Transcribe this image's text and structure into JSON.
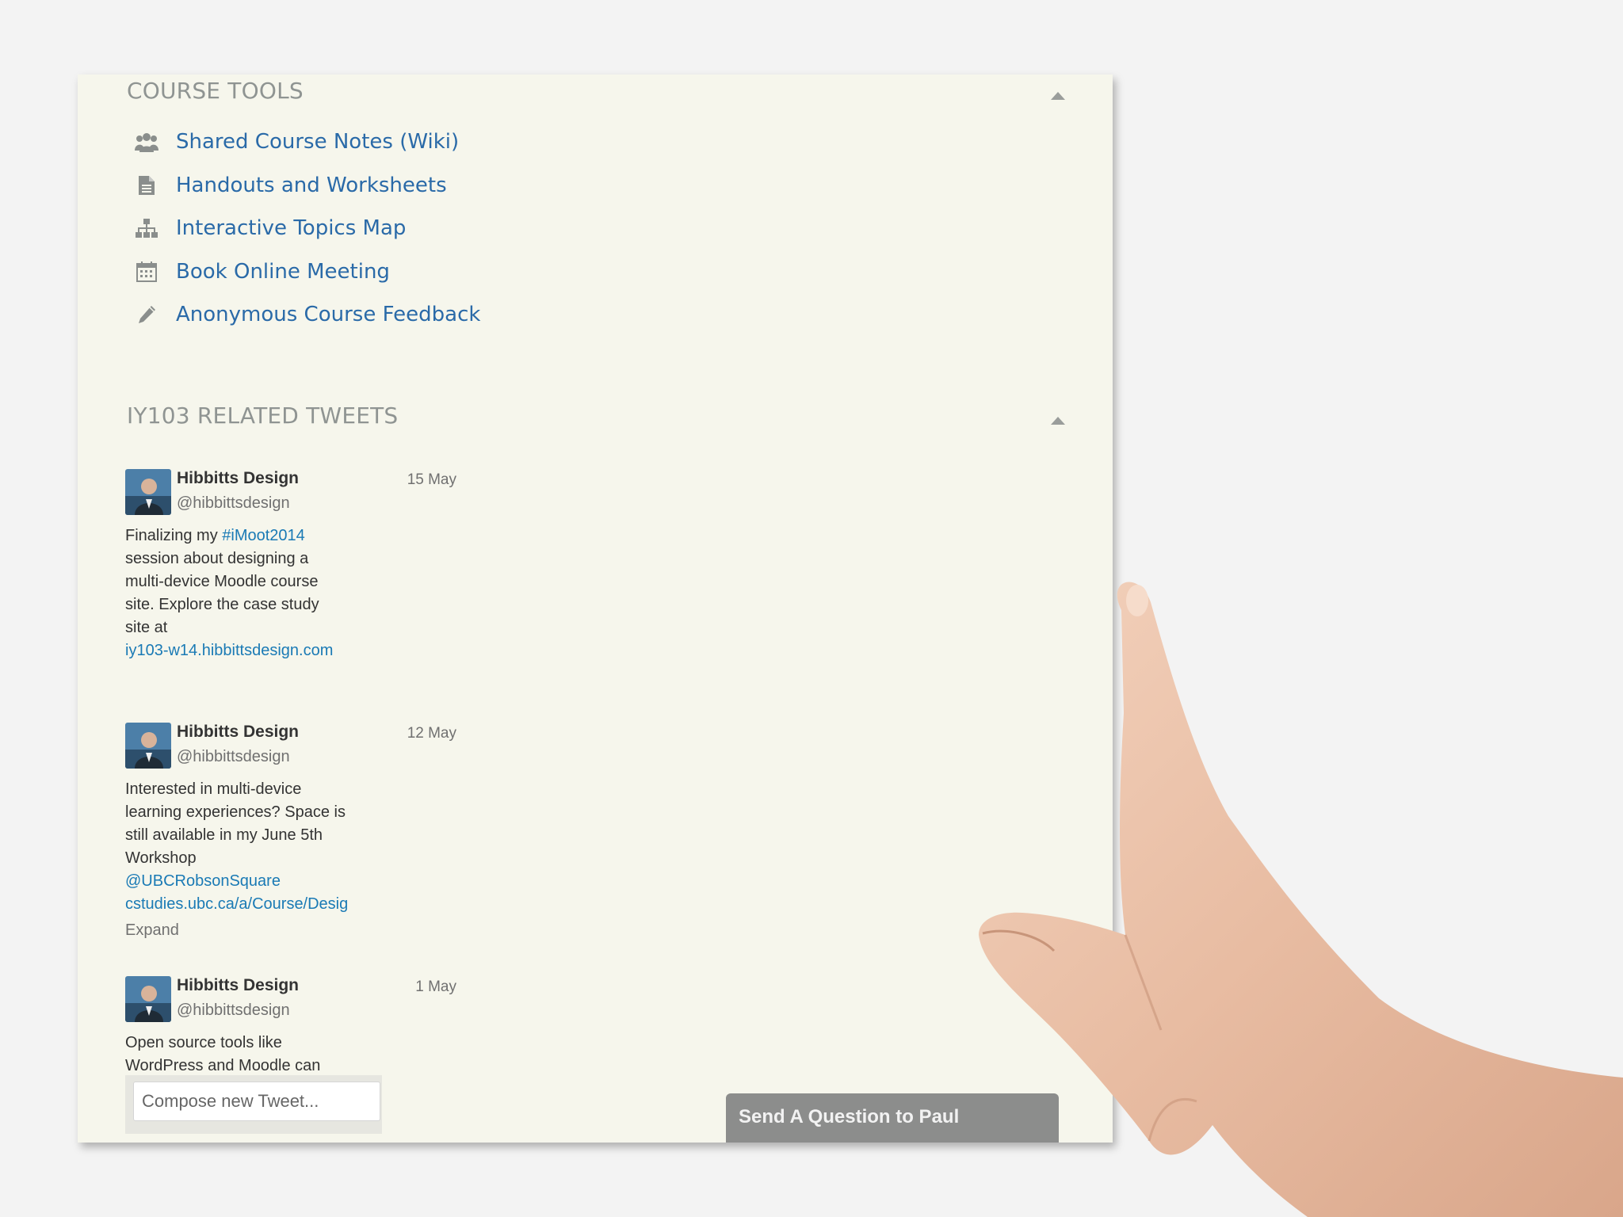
{
  "course_tools": {
    "title": "COURSE TOOLS",
    "items": [
      {
        "label": "Shared Course Notes (Wiki)",
        "icon": "users-icon"
      },
      {
        "label": "Handouts and Worksheets",
        "icon": "document-icon"
      },
      {
        "label": "Interactive Topics Map",
        "icon": "sitemap-icon"
      },
      {
        "label": "Book Online Meeting",
        "icon": "calendar-icon"
      },
      {
        "label": "Anonymous Course Feedback",
        "icon": "pencil-icon"
      }
    ]
  },
  "tweets_section": {
    "title": "IY103 RELATED TWEETS",
    "tweets": [
      {
        "name": "Hibbitts Design",
        "handle": "@hibbittsdesign",
        "date": "15 May",
        "lines": [
          "Finalizing my ",
          "#iMoot2014",
          "session about designing a",
          "multi-device Moodle course",
          "site. Explore the case study",
          "site at",
          "iy103-w14.hibbittsdesign.com"
        ]
      },
      {
        "name": "Hibbitts Design",
        "handle": "@hibbittsdesign",
        "date": "12 May",
        "lines": [
          "Interested in multi-device",
          "learning experiences? Space is",
          "still available in my June 5th",
          "Workshop",
          "@UBCRobsonSquare",
          "cstudies.ubc.ca/a/Course/Desig"
        ],
        "expand": "Expand"
      },
      {
        "name": "Hibbitts Design",
        "handle": "@hibbittsdesign",
        "date": "1 May",
        "lines": [
          "Open source tools like",
          "WordPress and Moodle can"
        ]
      }
    ],
    "compose_placeholder": "Compose new Tweet..."
  },
  "ask_button": "Send A Question to Paul"
}
